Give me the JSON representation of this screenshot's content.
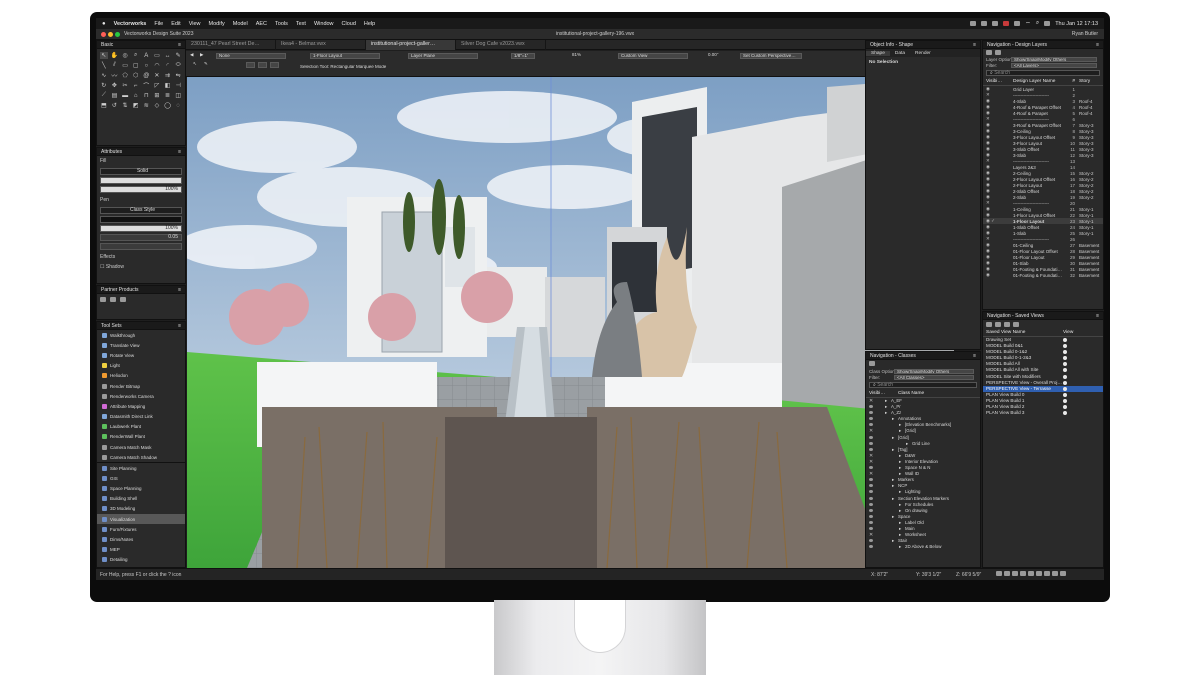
{
  "menubar": {
    "apple": "",
    "app": "Vectorworks",
    "items": [
      "File",
      "Edit",
      "View",
      "Modify",
      "Model",
      "AEC",
      "Tools",
      "Text",
      "Window",
      "Cloud",
      "Help"
    ],
    "datetime": "Thu Jan 12  17:13"
  },
  "titlebar": {
    "suite": "Vectorworks Design Suite 2023",
    "doc": "institutional-project-gallery-196.vwx",
    "user": "Ryan Butler"
  },
  "tabs": [
    "230111_47 Pearl Street De…",
    "Ikea4 - Belmar.vwx",
    "institutional-project-galler…",
    "Silver Dog Cafe v2023.vwx"
  ],
  "viewbar": {
    "class": "None",
    "layer": "1-Floor Layout",
    "layer2": "Layer Plane",
    "scale": "1/8\"=1'",
    "zoom": "81%",
    "view": "Custom View",
    "rotation": "0.00°",
    "render": "Set Custom Perspective…",
    "mode": "Selection Tool: Rectangular Marquee Mode"
  },
  "basic": {
    "title": "Basic"
  },
  "attributes": {
    "title": "Attributes",
    "fill_label": "Fill",
    "fill_value": "Solid",
    "fill_pct": "100%",
    "pen_label": "Pen",
    "pen_value": "Class Style",
    "pen_pct": "100%",
    "pen_weight": "0.05",
    "effects": "Effects",
    "shadow": "Shadow"
  },
  "partner": {
    "title": "Partner Products"
  },
  "toolsets": {
    "title": "Tool Sets",
    "tools": [
      {
        "label": "Walkthrough",
        "color": "#7fa6d8"
      },
      {
        "label": "Translate View",
        "color": "#7fa6d8"
      },
      {
        "label": "Rotate View",
        "color": "#7fa6d8"
      },
      {
        "label": "Light",
        "color": "#f0d040"
      },
      {
        "label": "Heliodon",
        "color": "#f09a30"
      },
      {
        "label": "Render Bitmap",
        "color": "#9a9a9a"
      },
      {
        "label": "Renderworks Camera",
        "color": "#9a9a9a"
      },
      {
        "label": "Attribute Mapping",
        "color": "#d26ad6"
      },
      {
        "label": "Datasmith Direct Link",
        "color": "#7fa6d8"
      },
      {
        "label": "Laubwerk Plant",
        "color": "#5cc05c"
      },
      {
        "label": "RenderWall Plant",
        "color": "#5cc05c"
      },
      {
        "label": "Camera Match Mask",
        "color": "#9a9a9a"
      },
      {
        "label": "Camera Match Shadow",
        "color": "#9a9a9a"
      }
    ],
    "sets": [
      "Site Planning",
      "GIS",
      "Space Planning",
      "Building Shell",
      "3D Modeling",
      "Visualization",
      "Furn/Fixtures",
      "Dims/Notes",
      "MEP",
      "Detailing",
      "Fasteners",
      "Machine Components"
    ],
    "selected_set": "Visualization"
  },
  "objinfo": {
    "title": "Object Info - Shape",
    "tabs": [
      "Shape",
      "Data",
      "Render"
    ],
    "status": "No Selection"
  },
  "classes": {
    "title": "Navigation - Classes",
    "options_label": "Class Options:",
    "options_value": "Show/Snap/Modify Others",
    "filter_label": "Filter:",
    "filter_value": "<All Classes>",
    "search": "Search",
    "col_vis": "Visibi…",
    "col_name": "Class Name",
    "rows": [
      {
        "t": "A_EF",
        "i": 3,
        "m": "x"
      },
      {
        "t": "A_Pr",
        "i": 3,
        "m": "e"
      },
      {
        "t": "A_Zz",
        "i": 3,
        "m": "e"
      },
      {
        "t": "Annotations",
        "i": 4,
        "m": "e"
      },
      {
        "t": "[Elevation Benchmarks]",
        "i": 5,
        "m": "e"
      },
      {
        "t": "[Grid]",
        "i": 5,
        "m": "x"
      },
      {
        "t": "[Grid]",
        "i": 4,
        "m": "e"
      },
      {
        "t": "Grid Line",
        "i": 6,
        "m": "e"
      },
      {
        "t": "[Tag]",
        "i": 4,
        "m": "e"
      },
      {
        "t": "D&W",
        "i": 5,
        "m": "x"
      },
      {
        "t": "Interior Elevation",
        "i": 5,
        "m": "x"
      },
      {
        "t": "Space N & N",
        "i": 5,
        "m": "e"
      },
      {
        "t": "Wall ID",
        "i": 5,
        "m": "x"
      },
      {
        "t": "Markers",
        "i": 4,
        "m": "e"
      },
      {
        "t": "NCP",
        "i": 4,
        "m": "e"
      },
      {
        "t": "Lighting",
        "i": 5,
        "m": "e"
      },
      {
        "t": "Section Elevation Markers",
        "i": 4,
        "m": "e"
      },
      {
        "t": "For Schedules",
        "i": 5,
        "m": "e"
      },
      {
        "t": "On drawing",
        "i": 5,
        "m": "e"
      },
      {
        "t": "Space",
        "i": 4,
        "m": "e"
      },
      {
        "t": "Label Old",
        "i": 5,
        "m": "e"
      },
      {
        "t": "Main",
        "i": 5,
        "m": "e"
      },
      {
        "t": "Worksheet",
        "i": 5,
        "m": "x"
      },
      {
        "t": "Stair",
        "i": 4,
        "m": "e"
      },
      {
        "t": "2D Above & Below",
        "i": 5,
        "m": "e"
      }
    ]
  },
  "layers": {
    "title": "Navigation - Design Layers",
    "options_label": "Layer Options:",
    "options_value": "Show/Snap/Modify Others",
    "filter_label": "Filter:",
    "filter_value": "<All Layers>",
    "search": "Search",
    "col_vis": "Visibi…",
    "col_name": "Design Layer Name",
    "col_num": "#",
    "col_story": "Story",
    "rows": [
      {
        "n": "Grid Layer",
        "num": "1",
        "s": ""
      },
      {
        "n": "------------------------",
        "num": "2",
        "s": ""
      },
      {
        "n": "4-Slab",
        "num": "3",
        "s": "Roof-4"
      },
      {
        "n": "4-Roof & Parapet Offset",
        "num": "4",
        "s": "Roof-4"
      },
      {
        "n": "4-Roof & Parapet",
        "num": "5",
        "s": "Roof-4"
      },
      {
        "n": "------------------------",
        "num": "6",
        "s": ""
      },
      {
        "n": "3-Roof & Parapet Offset",
        "num": "7",
        "s": "Story-3"
      },
      {
        "n": "3-Ceiling",
        "num": "8",
        "s": "Story-3"
      },
      {
        "n": "3-Floor Layout Offset",
        "num": "9",
        "s": "Story-3"
      },
      {
        "n": "3-Floor Layout",
        "num": "10",
        "s": "Story-3"
      },
      {
        "n": "3-Slab Offset",
        "num": "11",
        "s": "Story-3"
      },
      {
        "n": "3-Slab",
        "num": "12",
        "s": "Story-3"
      },
      {
        "n": "------------------------",
        "num": "13",
        "s": ""
      },
      {
        "n": "Layers 2&3",
        "num": "14",
        "s": ""
      },
      {
        "n": "2-Ceiling",
        "num": "15",
        "s": "Story-2"
      },
      {
        "n": "2-Floor Layout Offset",
        "num": "16",
        "s": "Story-2"
      },
      {
        "n": "2-Floor Layout",
        "num": "17",
        "s": "Story-2"
      },
      {
        "n": "2-Slab Offset",
        "num": "18",
        "s": "Story-2"
      },
      {
        "n": "2-Slab",
        "num": "19",
        "s": "Story-2"
      },
      {
        "n": "------------------------",
        "num": "20",
        "s": ""
      },
      {
        "n": "1-Ceiling",
        "num": "21",
        "s": "Story-1"
      },
      {
        "n": "1-Floor Layout Offset",
        "num": "22",
        "s": "Story-1"
      },
      {
        "n": "1-Floor Layout",
        "num": "23",
        "s": "Story-1"
      },
      {
        "n": "1-Slab Offset",
        "num": "24",
        "s": "Story-1"
      },
      {
        "n": "1-Slab",
        "num": "25",
        "s": "Story-1"
      },
      {
        "n": "------------------------",
        "num": "26",
        "s": ""
      },
      {
        "n": "01-Ceiling",
        "num": "27",
        "s": "Basement"
      },
      {
        "n": "01-Floor Layout Offset",
        "num": "28",
        "s": "Basement"
      },
      {
        "n": "01-Floor Layout",
        "num": "29",
        "s": "Basement"
      },
      {
        "n": "01-Slab",
        "num": "30",
        "s": "Basement"
      },
      {
        "n": "01-Footing & Foundati…",
        "num": "31",
        "s": "Basement"
      },
      {
        "n": "01-Footing & Foundati…",
        "num": "32",
        "s": "Basement"
      }
    ],
    "active_row": "1-Floor Layout"
  },
  "savedviews": {
    "title": "Navigation - Saved Views",
    "col_name": "Saved View Name",
    "col_view": "View",
    "rows": [
      "Drawing Set",
      "MODEL Build 0&1",
      "MODEL Build 0-1&2",
      "MODEL Build 0-1-2&3",
      "MODEL Build All",
      "MODEL Build All with Site",
      "MODEL Site with Modifiers",
      "PERSPECTIVE View - Overall Proj…",
      "PERSPECTIVE View - Terrasse",
      "PLAN View Build 0",
      "PLAN View Build 1",
      "PLAN View Build 2",
      "PLAN View Build 3"
    ],
    "selected": "PERSPECTIVE View - Terrasse"
  },
  "status": {
    "help": "For Help, press F1 or click the ? icon",
    "x": "X: 87'2\"",
    "y": "Y: 39'3 1/2\"",
    "z": "Z: 66'9 5/9\""
  }
}
